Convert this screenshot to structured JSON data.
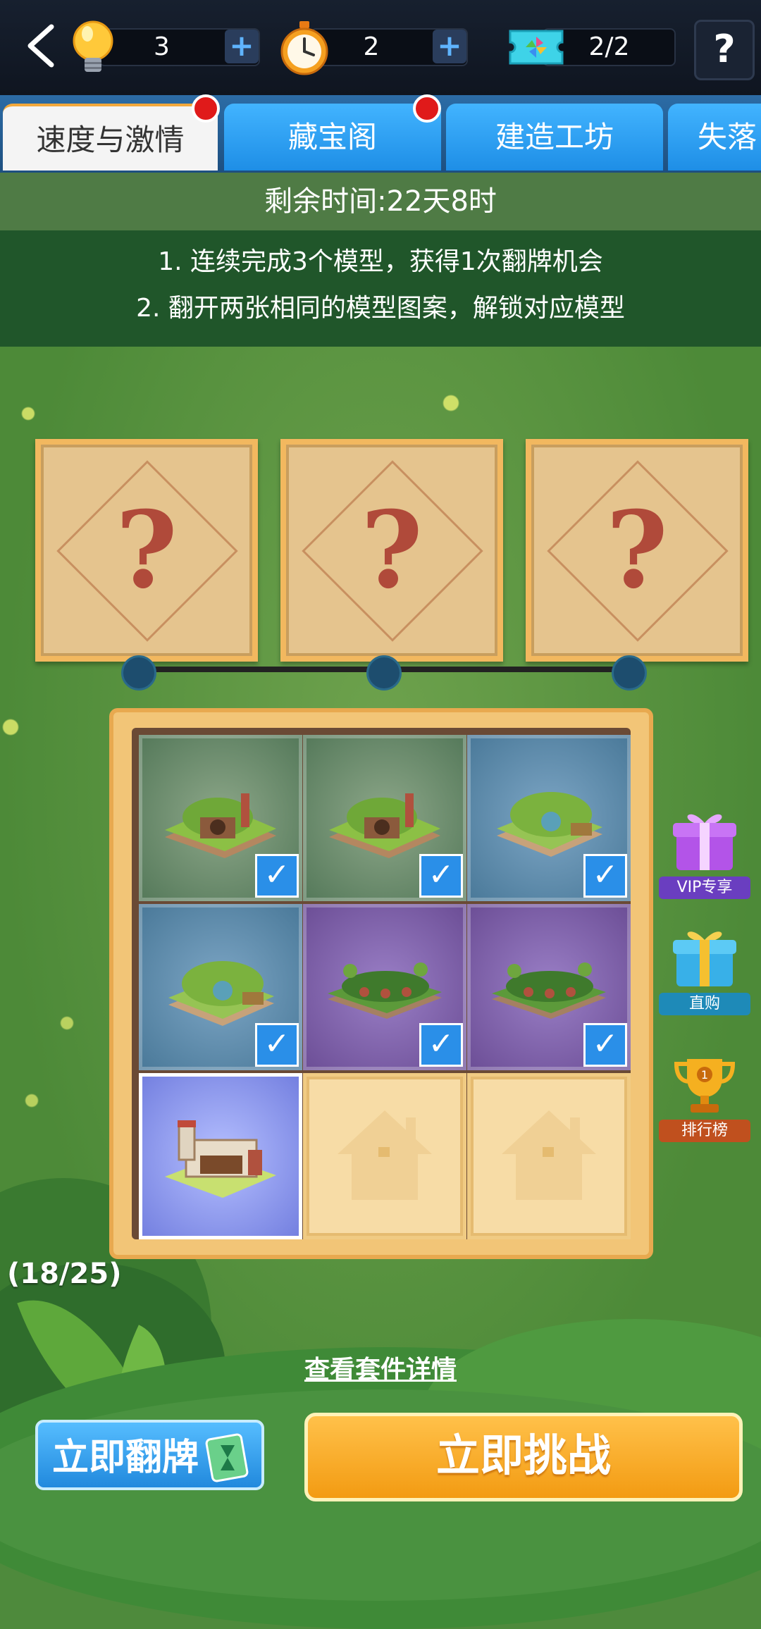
{
  "header": {
    "resources": [
      {
        "name": "lightbulb",
        "value": "3"
      },
      {
        "name": "stopwatch",
        "value": "2"
      },
      {
        "name": "ticket",
        "value": "2/2"
      }
    ],
    "help_label": "?"
  },
  "tabs": [
    {
      "label": "速度与激情",
      "active": true,
      "badge": true
    },
    {
      "label": "藏宝阁",
      "active": false,
      "badge": true
    },
    {
      "label": "建造工坊",
      "active": false,
      "badge": false
    },
    {
      "label": "失落",
      "active": false,
      "badge": false
    }
  ],
  "info": {
    "timer": "剩余时间:22天8时",
    "rules": [
      "1. 连续完成3个模型，获得1次翻牌机会",
      "2. 翻开两张相同的模型图案，解锁对应模型"
    ]
  },
  "cards": [
    {
      "label": "?"
    },
    {
      "label": "?"
    },
    {
      "label": "?"
    }
  ],
  "board": {
    "tiles": [
      {
        "kind": "green",
        "checked": true
      },
      {
        "kind": "green",
        "checked": true
      },
      {
        "kind": "blue",
        "checked": true
      },
      {
        "kind": "blue",
        "checked": true
      },
      {
        "kind": "purple",
        "checked": true
      },
      {
        "kind": "purple",
        "checked": true
      },
      {
        "kind": "selected",
        "checked": false
      },
      {
        "kind": "empty",
        "checked": false
      },
      {
        "kind": "empty",
        "checked": false
      }
    ]
  },
  "side": {
    "vip": "VIP专享",
    "buy": "直购",
    "rank": "排行榜"
  },
  "progress_count": "(18/25)",
  "detail_link": "查看套件详情",
  "buttons": {
    "flip": "立即翻牌",
    "challenge": "立即挑战"
  },
  "colors": {
    "accent_orange": "#f39b12",
    "accent_blue": "#2189dd",
    "badge_red": "#e01a1a"
  }
}
